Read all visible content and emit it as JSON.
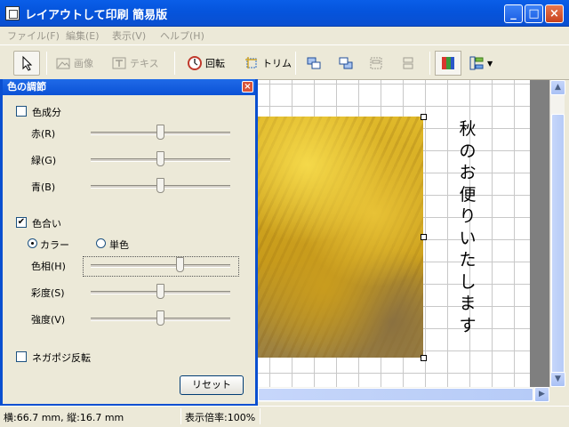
{
  "window": {
    "title": "レイアウトして印刷 簡易版"
  },
  "menu": [
    "ファイル(F)",
    "編集(E)",
    "表示(V)",
    "ヘルプ(H)"
  ],
  "toolbar": {
    "image_label": "画像",
    "text_label": "テキス",
    "rotate_label": "回転",
    "trim_label": "トリム"
  },
  "dialog": {
    "title": "色の調節",
    "color_component": {
      "label": "色成分",
      "checked": false
    },
    "red_label": "赤(R)",
    "green_label": "緑(G)",
    "blue_label": "青(B)",
    "hue_group": {
      "label": "色合い",
      "checked": true
    },
    "color_radio": "カラー",
    "mono_radio": "単色",
    "hue_label": "色相(H)",
    "saturation_label": "彩度(S)",
    "intensity_label": "強度(V)",
    "negpos": {
      "label": "ネガポジ反転",
      "checked": false
    },
    "reset_label": "リセット"
  },
  "canvas": {
    "vertical_text": [
      "秋",
      "の",
      "お",
      "便",
      "り",
      "い",
      "た",
      "し",
      "ま",
      "す"
    ]
  },
  "status": {
    "size": "横:66.7 mm, 縦:16.7 mm",
    "zoom": "表示倍率:100%"
  },
  "colors": {
    "titlebar": "#0a5ee8",
    "photo": "#e0b92a"
  }
}
